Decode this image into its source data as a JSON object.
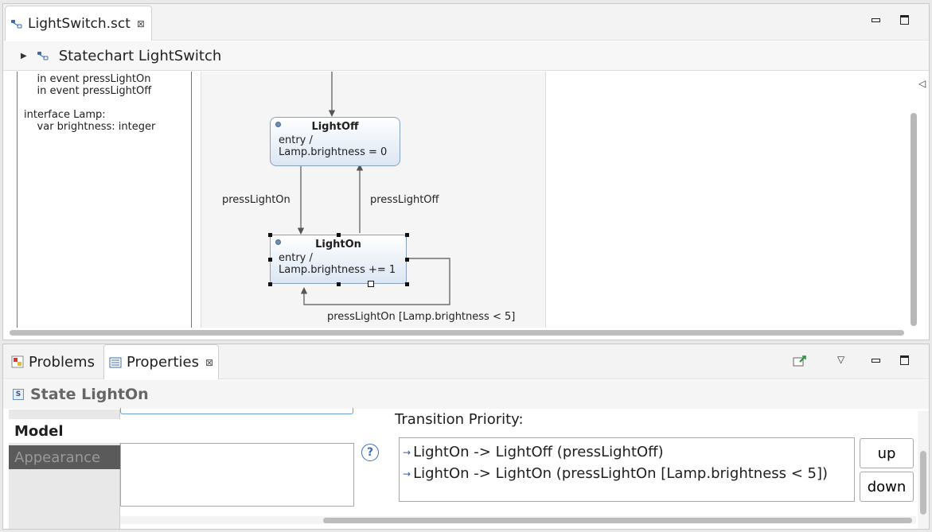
{
  "editor": {
    "tab_title": "LightSwitch.sct",
    "tab_close": "⊠",
    "breadcrumb": "Statechart LightSwitch"
  },
  "definition": {
    "text": "    in event pressLightOn\n    in event pressLightOff\n\ninterface Lamp:\n    var brightness: integer"
  },
  "diagram": {
    "states": [
      {
        "name": "LightOff",
        "body": "entry /\nLamp.brightness = 0"
      },
      {
        "name": "LightOn",
        "body": "entry /\nLamp.brightness += 1"
      }
    ],
    "transitions": [
      {
        "label": "pressLightOn"
      },
      {
        "label": "pressLightOff"
      },
      {
        "label": "pressLightOn [Lamp.brightness < 5]"
      }
    ]
  },
  "properties": {
    "tabs": [
      {
        "label": "Problems"
      },
      {
        "label": "Properties"
      }
    ],
    "tab_close": "⊠",
    "header": "State LightOn",
    "header_icon_letter": "S",
    "side_tabs": [
      "Model",
      "Appearance"
    ],
    "help_glyph": "?",
    "priority_label": "Transition Priority:",
    "priority_items": [
      "LightOn -> LightOff (pressLightOff)",
      "LightOn -> LightOn (pressLightOn [Lamp.brightness < 5])"
    ],
    "up_label": "up",
    "down_label": "down"
  },
  "colors": {
    "state_border": "#8aa0bf",
    "state_fill_top": "#ffffff",
    "state_fill_bottom": "#dbe6f3",
    "accent_blue": "#2a5aa8",
    "appearance_tab_bg": "#5a5a5a"
  },
  "icons": {
    "statechart": "statechart-icon",
    "problems": "problems-icon",
    "properties": "properties-icon",
    "state": "state-icon",
    "help": "help-icon"
  }
}
